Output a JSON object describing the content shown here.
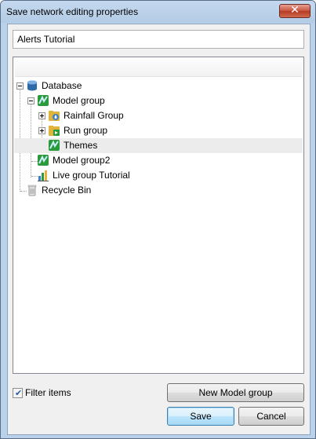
{
  "window": {
    "title": "Save network editing properties"
  },
  "name_field": {
    "value": "Alerts Tutorial"
  },
  "tree": {
    "items": [
      {
        "label": "Database",
        "icon": "database-icon"
      },
      {
        "label": "Model group",
        "icon": "model-group-icon"
      },
      {
        "label": "Rainfall Group",
        "icon": "rainfall-group-icon"
      },
      {
        "label": "Run group",
        "icon": "run-group-icon"
      },
      {
        "label": "Themes",
        "icon": "themes-icon",
        "selected": true
      },
      {
        "label": "Model group2",
        "icon": "model-group-icon"
      },
      {
        "label": "Live group Tutorial",
        "icon": "live-group-icon"
      },
      {
        "label": "Recycle Bin",
        "icon": "recycle-bin-icon"
      }
    ]
  },
  "filter": {
    "label": "Filter items",
    "checked": true
  },
  "buttons": {
    "new_group": "New Model group",
    "save": "Save",
    "cancel": "Cancel"
  },
  "colors": {
    "title_bar": "#b9d1ea",
    "close_button": "#c9523c",
    "selected_row": "#ececec",
    "default_button": "#3c7fb1"
  }
}
